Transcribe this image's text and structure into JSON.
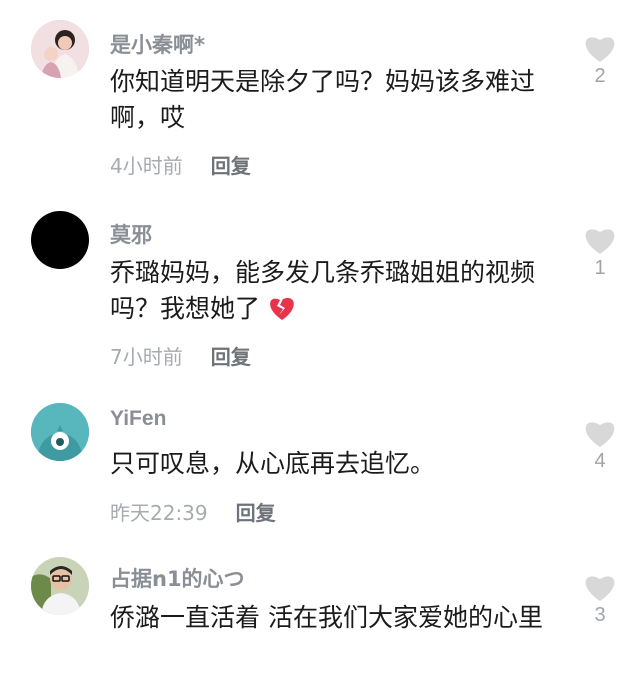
{
  "comments": [
    {
      "username": "是小秦啊*",
      "text": "你知道明天是除夕了吗？妈妈该多难过啊，哎",
      "time": "4小时前",
      "reply_label": "回复",
      "likes": "2"
    },
    {
      "username": "莫邪",
      "text": "乔璐妈妈，能多发几条乔璐姐姐的视频吗？我想她了",
      "time": "7小时前",
      "reply_label": "回复",
      "likes": "1",
      "emoji": "broken-heart-icon"
    },
    {
      "username": "YiFen",
      "text": "只可叹息，从心底再去追忆。",
      "time": "昨天22:39",
      "reply_label": "回复",
      "likes": "4"
    },
    {
      "username": "占据n1的心つ",
      "text": "侨潞一直活着 活在我们大家爱她的心里",
      "time": "",
      "reply_label": "",
      "likes": "3"
    }
  ],
  "colors": {
    "like_heart": "#d8d8d8",
    "broken_heart": "#e8344a",
    "yifen_avatar": "#58b7bd"
  }
}
